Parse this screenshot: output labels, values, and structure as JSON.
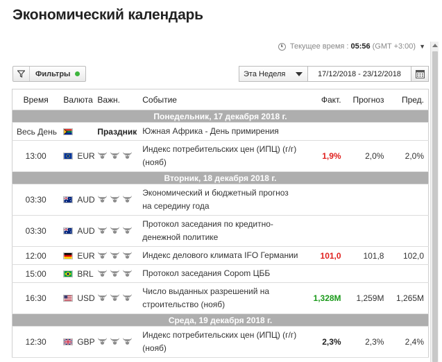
{
  "page": {
    "title": "Экономический календарь"
  },
  "time_info": {
    "label": "Текущее время :",
    "time": "05:56",
    "timezone": "(GMT +3:00)"
  },
  "toolbar": {
    "filters_label": "Фильтры",
    "week_select": "Эта Неделя",
    "date_range": "17/12/2018 - 23/12/2018"
  },
  "table": {
    "headers": {
      "time": "Время",
      "currency": "Валюта",
      "importance": "Важн.",
      "event": "Событие",
      "actual": "Факт.",
      "forecast": "Прогноз",
      "previous": "Пред."
    },
    "rows": [
      {
        "type": "day",
        "label": "Понедельник, 17 декабря 2018 г."
      },
      {
        "type": "holiday",
        "time": "Весь День",
        "flag": "ZA",
        "importance": "Праздник",
        "event": "Южная Африка - День примирения"
      },
      {
        "type": "event",
        "time": "13:00",
        "flag": "EU",
        "currency": "EUR",
        "bulls": 3,
        "event": "Индекс потребительских цен (ИПЦ) (г/г) (нояб)",
        "actual": "1,9%",
        "actual_color": "#e0201e",
        "forecast": "2,0%",
        "previous": "2,0%"
      },
      {
        "type": "day",
        "label": "Вторник, 18 декабря 2018 г."
      },
      {
        "type": "event",
        "time": "03:30",
        "flag": "AU",
        "currency": "AUD",
        "bulls": 3,
        "event": "Экономический и бюджетный прогноз на середину года",
        "actual": "",
        "forecast": "",
        "previous": ""
      },
      {
        "type": "event",
        "time": "03:30",
        "flag": "AU",
        "currency": "AUD",
        "bulls": 3,
        "event": "Протокол заседания по кредитно-денежной политике",
        "actual": "",
        "forecast": "",
        "previous": ""
      },
      {
        "type": "event",
        "time": "12:00",
        "flag": "DE",
        "currency": "EUR",
        "bulls": 3,
        "event": "Индекс делового климата IFO Германии",
        "actual": "101,0",
        "actual_color": "#e0201e",
        "forecast": "101,8",
        "previous": "102,0"
      },
      {
        "type": "event",
        "time": "15:00",
        "flag": "BR",
        "currency": "BRL",
        "bulls": 3,
        "event": "Протокол заседания Copom ЦББ",
        "actual": "",
        "forecast": "",
        "previous": ""
      },
      {
        "type": "event",
        "time": "16:30",
        "flag": "US",
        "currency": "USD",
        "bulls": 3,
        "event": "Число выданных разрешений на строительство (нояб)",
        "actual": "1,328M",
        "actual_color": "#1a9a1a",
        "forecast": "1,259M",
        "previous": "1,265M"
      },
      {
        "type": "day",
        "label": "Среда, 19 декабря 2018 г."
      },
      {
        "type": "event",
        "time": "12:30",
        "flag": "GB",
        "currency": "GBP",
        "bulls": 3,
        "event": "Индекс потребительских цен (ИПЦ) (г/г) (нояб)",
        "actual": "2,3%",
        "actual_color": "#222222",
        "forecast": "2,3%",
        "previous": "2,4%"
      }
    ]
  }
}
